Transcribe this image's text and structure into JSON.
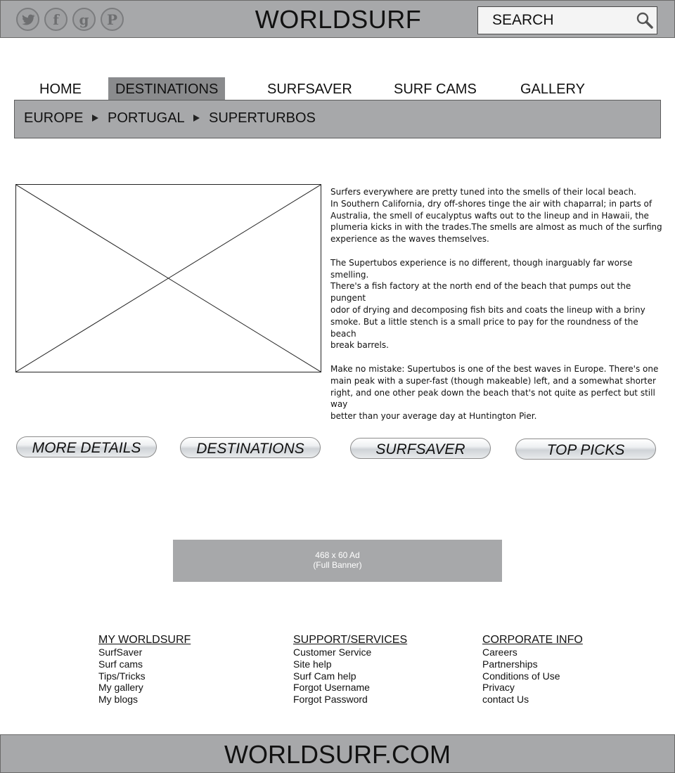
{
  "header": {
    "title": "WORLDSURF",
    "social": {
      "twitter_icon": "twitter-icon",
      "facebook_icon": "facebook-icon",
      "google_icon": "google-icon",
      "pinterest_icon": "pinterest-icon",
      "facebook_glyph": "f",
      "google_glyph": "g",
      "pinterest_glyph": "P"
    },
    "search": {
      "placeholder": "SEARCH"
    }
  },
  "nav": {
    "items": [
      {
        "label": "HOME"
      },
      {
        "label": "DESTINATIONS",
        "active": true
      },
      {
        "label": "SURFSAVER"
      },
      {
        "label": "SURF CAMS"
      },
      {
        "label": "GALLERY"
      }
    ]
  },
  "breadcrumb": [
    "EUROPE",
    "PORTUGAL",
    "SUPERTURBOS"
  ],
  "article": {
    "paragraphs": [
      "Surfers everywhere are pretty tuned into the smells of their local beach.\nIn Southern California,  dry off-shores tinge the air with chaparral; in parts of\n Australia, the smell of eucalyptus wafts out to the lineup and in Hawaii, the\nplumeria kicks in with the trades.The smells are almost as much of the surfing\nexperience as the waves themselves.",
      "The Supertubos experience is no different, though inarguably far worse smelling.\nThere's a fish factory at the north end of the beach that pumps out the pungent\nodor of drying and decomposing fish bits and coats the lineup with a briny\nsmoke. But a little stench is a small price to pay for the roundness of the beach\nbreak barrels.",
      "Make no mistake: Supertubos is one of the best waves in Europe. There's one\nmain peak with a super-fast (though makeable) left, and a somewhat shorter\nright, and one other peak down the beach that's not quite as perfect but still way\n better than your average day at Huntington Pier."
    ]
  },
  "buttons": [
    "MORE DETAILS",
    "DESTINATIONS",
    "SURFSAVER",
    "TOP PICKS"
  ],
  "ad": {
    "line1": "468 x 60 Ad",
    "line2": "(Full Banner)"
  },
  "footer_links": [
    {
      "heading": "MY WORLDSURF",
      "links": [
        "SurfSaver",
        "Surf cams",
        "Tips/Tricks",
        "My gallery",
        "My blogs"
      ]
    },
    {
      "heading": "SUPPORT/SERVICES",
      "links": [
        "Customer Service",
        "Site help",
        "Surf Cam help",
        "Forgot Username",
        "Forgot Password"
      ]
    },
    {
      "heading": "CORPORATE INFO",
      "links": [
        "Careers",
        "Partnerships",
        "Conditions of Use",
        "Privacy",
        "contact Us"
      ]
    }
  ],
  "footer": {
    "title": "WORLDSURF.COM"
  },
  "colors": {
    "bar_gray": "#a7a8aa",
    "active_tab": "#8a8b8d",
    "border": "#5d5d5d"
  }
}
